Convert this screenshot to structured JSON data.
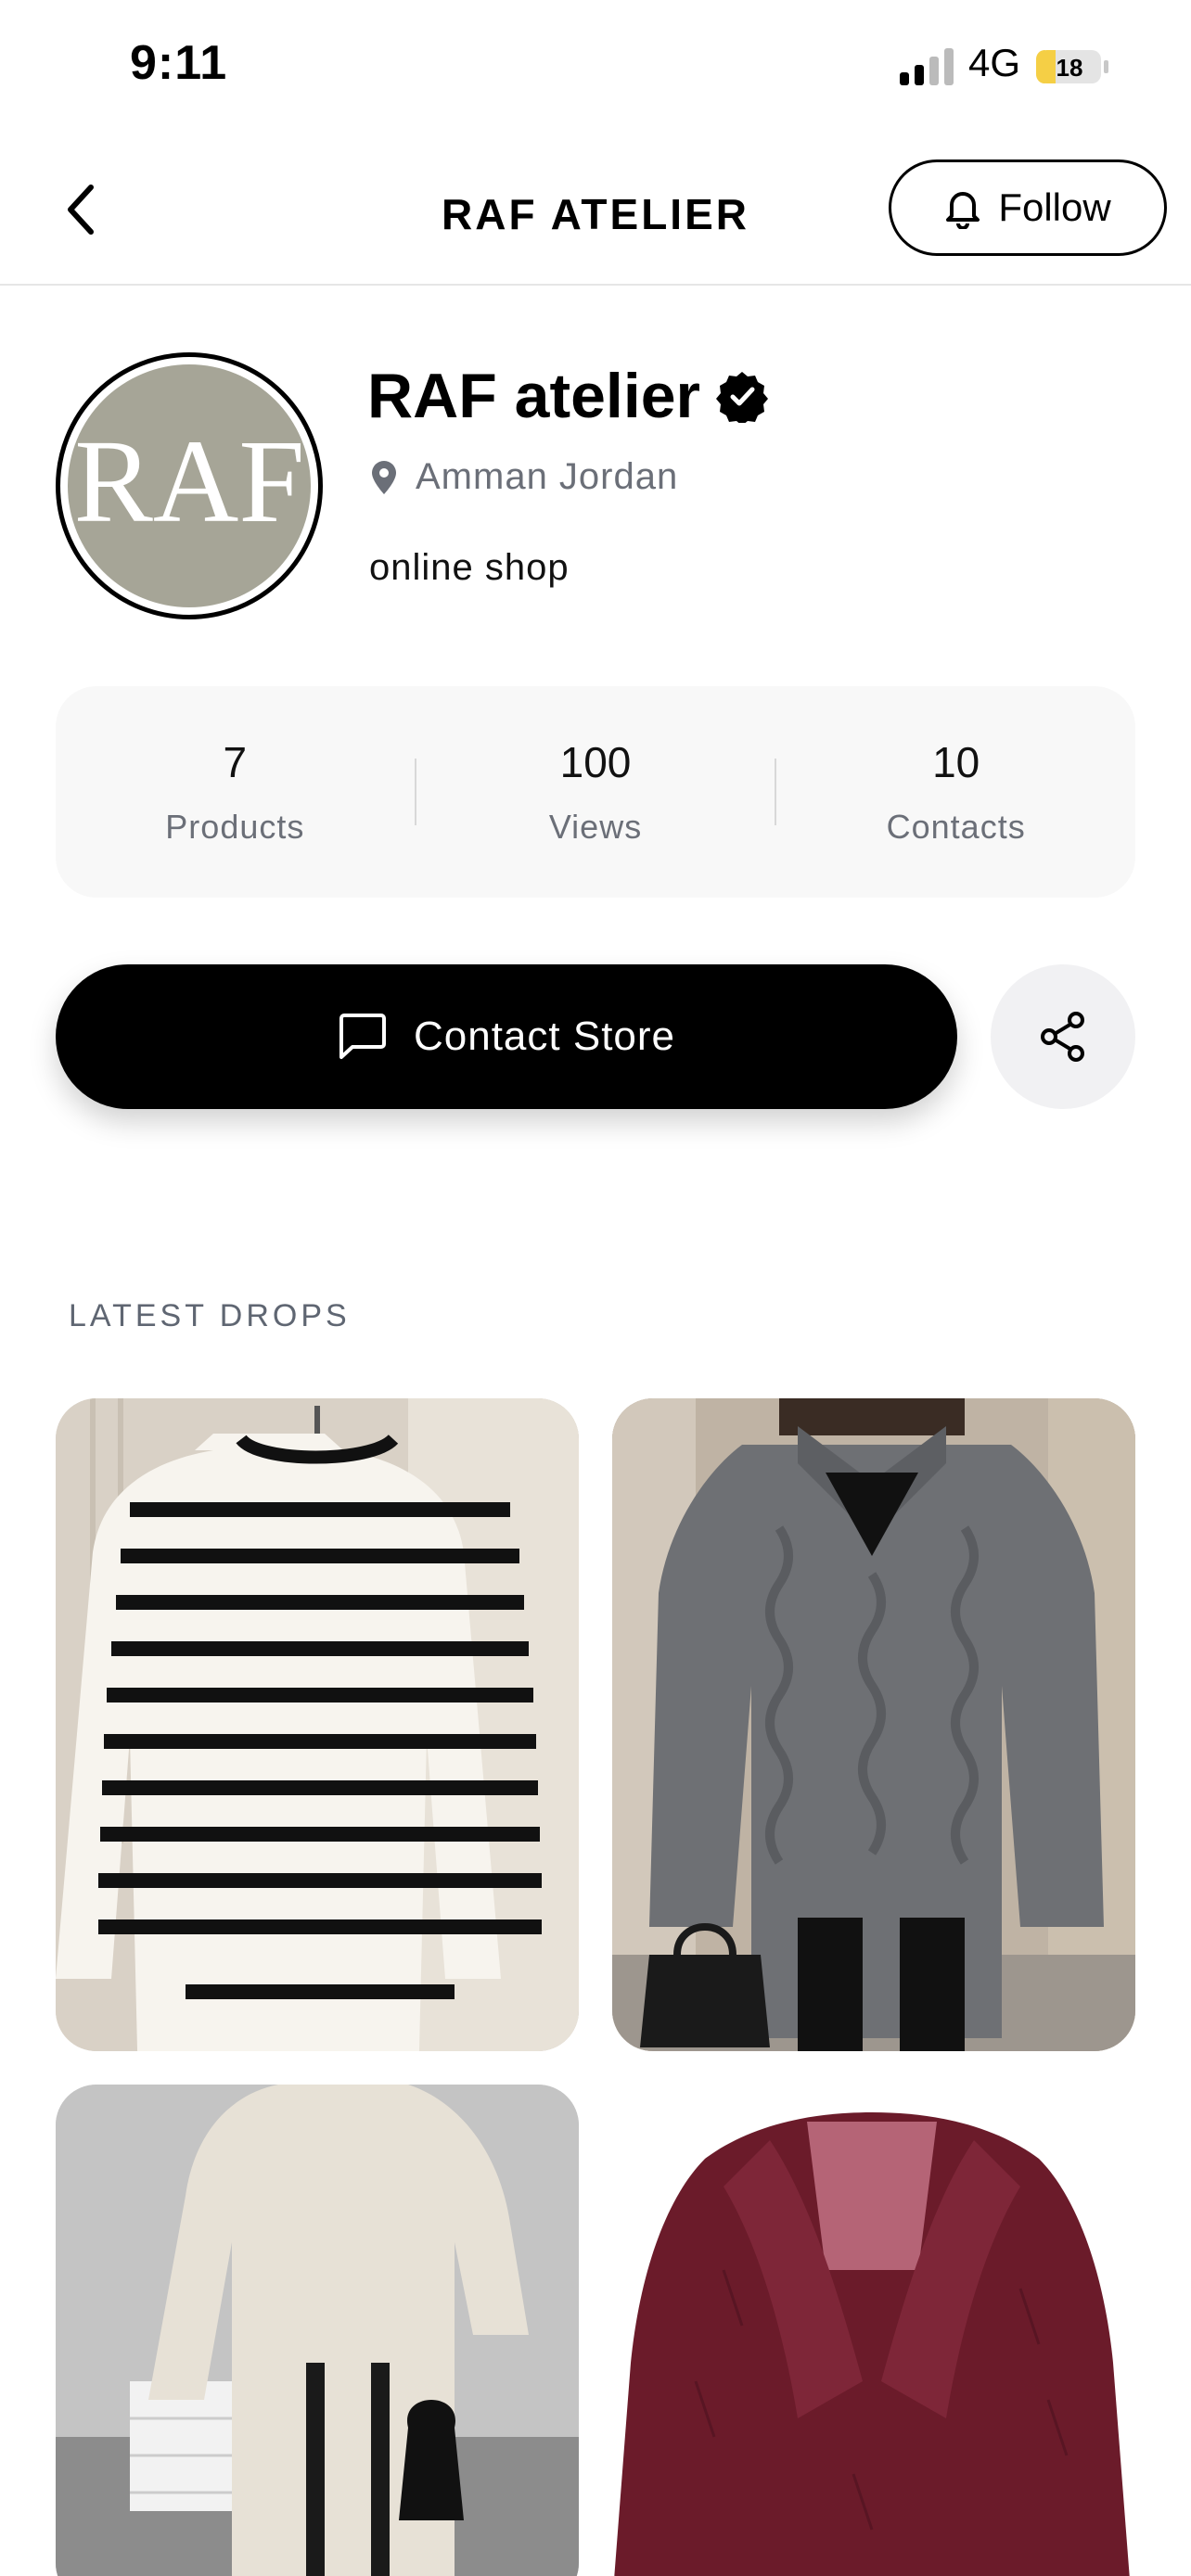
{
  "status_bar": {
    "time": "9:11",
    "network": "4G",
    "battery": "18"
  },
  "header": {
    "title": "RAF ATELIER",
    "follow_label": "Follow"
  },
  "profile": {
    "name": "RAF atelier",
    "avatar_text": "RAF",
    "location": "Amman Jordan",
    "bio": "online shop",
    "verified": true
  },
  "stats": [
    {
      "value": "7",
      "label": "Products"
    },
    {
      "value": "100",
      "label": "Views"
    },
    {
      "value": "10",
      "label": "Contacts"
    }
  ],
  "actions": {
    "contact_label": "Contact Store"
  },
  "section": {
    "title": "LATEST DROPS"
  },
  "icons": {
    "back": "chevron-left-icon",
    "follow": "bell-icon",
    "verified": "verified-badge-icon",
    "location": "map-pin-icon",
    "contact": "message-icon",
    "share": "share-icon"
  },
  "colors": {
    "primary": "#000000",
    "muted_text": "#6b6f78",
    "card_bg": "#f8f8f8",
    "battery_fill": "#f5cf45"
  }
}
